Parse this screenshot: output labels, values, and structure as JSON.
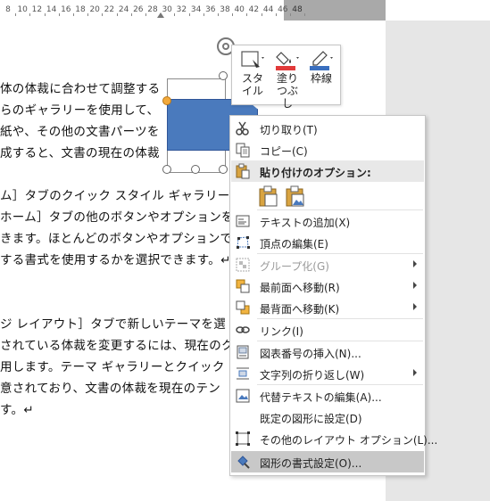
{
  "ruler": {
    "numbers": [
      "8",
      "10",
      "12",
      "14",
      "16",
      "18",
      "20",
      "22",
      "24",
      "26",
      "28",
      "30",
      "32",
      "34",
      "36",
      "38",
      "40",
      "42",
      "44",
      "46",
      "48"
    ]
  },
  "document": {
    "lines": [
      "体の体裁に合わせて調整する",
      "らのギャラリーを使用して、",
      "紙や、その他の文書パーツを",
      "成すると、文書の現在の体裁",
      "ム］タブのクイック スタイル ギャラリー",
      "ホーム］タブの他のボタンやオプションを",
      "きます。ほとんどのボタンやオプションで",
      "する書式を使用するかを選択できます。↵",
      "ジ レイアウト］タブで新しいテーマを選",
      "されている体裁を変更するには、現在のク",
      "用します。テーマ ギャラリーとクイック",
      "意されており、文書の体裁を現在のテン",
      "す。↵"
    ]
  },
  "mini_toolbar": {
    "style_label": "スタイル",
    "fill_label": "塗りつぶし",
    "outline_label": "枠線"
  },
  "context_menu": {
    "cut": "切り取り(T)",
    "copy": "コピー(C)",
    "paste_options": "貼り付けのオプション:",
    "add_text": "テキストの追加(X)",
    "edit_points": "頂点の編集(E)",
    "group": "グループ化(G)",
    "bring_front": "最前面へ移動(R)",
    "send_back": "最背面へ移動(K)",
    "link": "リンク(I)",
    "insert_caption": "図表番号の挿入(N)...",
    "wrap_text": "文字列の折り返し(W)",
    "edit_alt_text": "代替テキストの編集(A)...",
    "set_default": "既定の図形に設定(D)",
    "more_layout": "その他のレイアウト オプション(L)...",
    "format_shape": "図形の書式設定(O)..."
  },
  "colors": {
    "shape_fill": "#4a7abd",
    "fill_icon_red": "#e23a3a",
    "outline_icon_blue": "#3a6fbf",
    "highlight": "#c8c8c8"
  }
}
